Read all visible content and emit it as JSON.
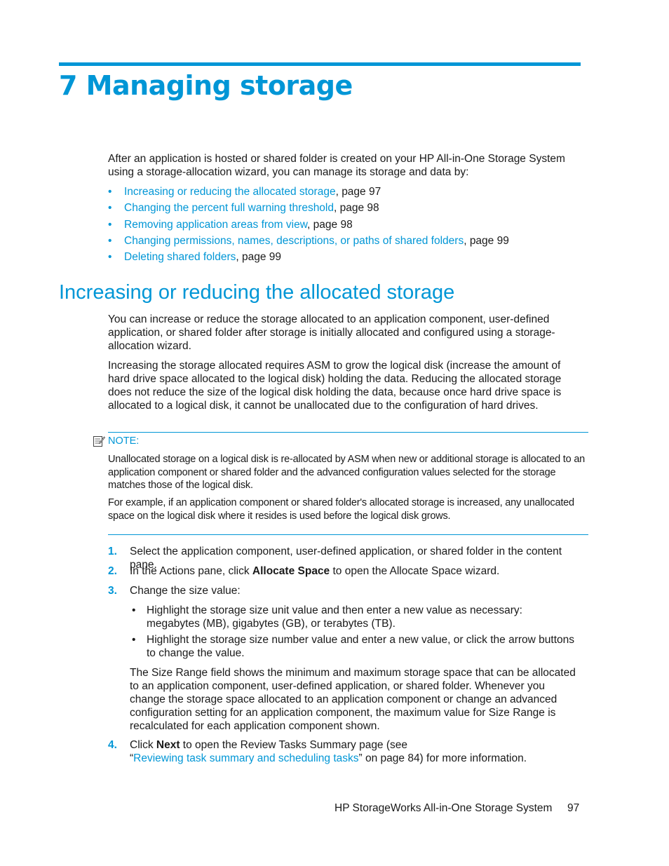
{
  "chapter": {
    "title": "7 Managing storage"
  },
  "intro": {
    "text": "After an application is hosted or shared folder is created on your HP All-in-One Storage System using a storage-allocation wizard, you can manage its storage and data by:",
    "toc": [
      {
        "link": "Increasing or reducing the allocated storage",
        "suffix": ", page 97"
      },
      {
        "link": "Changing the percent full warning threshold",
        "suffix": ", page 98"
      },
      {
        "link": "Removing application areas from view",
        "suffix": ", page 98"
      },
      {
        "link": "Changing permissions, names, descriptions, or paths of shared folders",
        "suffix": ", page 99"
      },
      {
        "link": "Deleting shared folders",
        "suffix": ", page 99"
      }
    ]
  },
  "section": {
    "title": "Increasing or reducing the allocated storage",
    "para1": "You can increase or reduce the storage allocated to an application component, user-defined application, or shared folder after storage is initially allocated and configured using a storage-allocation wizard.",
    "para2": "Increasing the storage allocated requires ASM to grow the logical disk (increase the amount of hard drive space allocated to the logical disk) holding the data. Reducing the allocated storage does not reduce the size of the logical disk holding the data, because once hard drive space is allocated to a logical disk, it cannot be unallocated due to the configuration of hard drives."
  },
  "note": {
    "label": "NOTE:",
    "p1": "Unallocated storage on a logical disk is re-allocated by ASM when new or additional storage is allocated to an application component or shared folder and the advanced configuration values selected for the storage matches those of the logical disk.",
    "p2": "For example, if an application component or shared folder's allocated storage is increased, any unallocated space on the logical disk where it resides is used before the logical disk grows."
  },
  "steps": [
    {
      "num": "1.",
      "text": "Select the application component, user-defined application, or shared folder in the content pane."
    },
    {
      "num": "2.",
      "pre": "In the Actions pane, click ",
      "bold": "Allocate Space",
      "post": " to open the Allocate Space wizard."
    },
    {
      "num": "3.",
      "text": "Change the size value:",
      "bullets": [
        "Highlight the storage size unit value and then enter a new value as necessary: megabytes (MB), gigabytes (GB), or terabytes (TB).",
        "Highlight the storage size number value and enter a new value, or click the arrow buttons to change the value."
      ],
      "note": "The Size Range field shows the minimum and maximum storage space that can be allocated to an application component, user-defined application, or shared folder. Whenever you change the storage space allocated to an application component or change an advanced configuration setting for an application component, the maximum value for Size Range is recalculated for each application component shown."
    },
    {
      "num": "4.",
      "pre": "Click ",
      "bold": "Next",
      "mid": " to open the Review Tasks Summary page (see",
      "quote_open": "“",
      "link": "Reviewing task summary and scheduling tasks",
      "post": "” on page 84) for more information."
    }
  ],
  "bullet_char": "•",
  "footer": {
    "title": "HP StorageWorks All-in-One Storage System",
    "page": "97"
  }
}
